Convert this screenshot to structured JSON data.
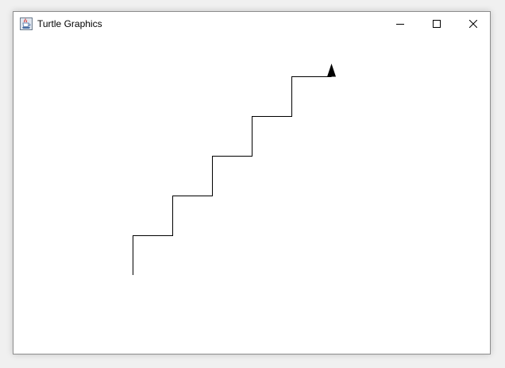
{
  "window": {
    "title": "Turtle Graphics",
    "icon": "java-coffee-cup-icon"
  },
  "controls": {
    "minimize_icon": "minimize-icon",
    "maximize_icon": "maximize-icon",
    "close_icon": "close-icon"
  },
  "drawing": {
    "line_color": "#000000",
    "turtle_color": "#000000",
    "turtle_icon": "turtle-arrow-icon",
    "turtle_heading": "up",
    "background_color": "#ffffff"
  }
}
